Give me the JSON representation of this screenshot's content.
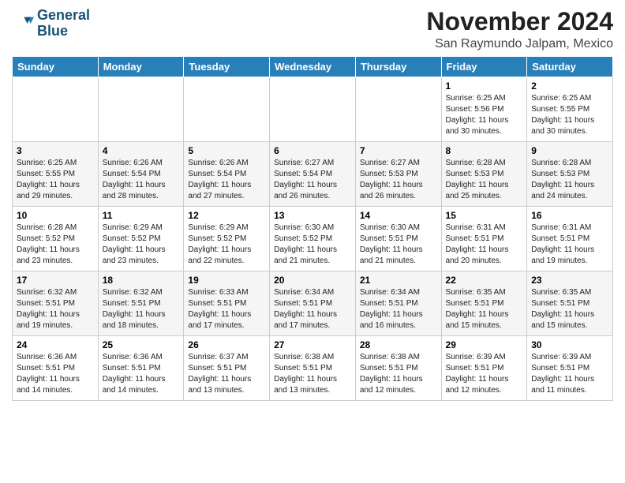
{
  "logo": {
    "line1": "General",
    "line2": "Blue"
  },
  "title": "November 2024",
  "location": "San Raymundo Jalpam, Mexico",
  "header": {
    "days": [
      "Sunday",
      "Monday",
      "Tuesday",
      "Wednesday",
      "Thursday",
      "Friday",
      "Saturday"
    ]
  },
  "weeks": [
    [
      {
        "day": "",
        "info": ""
      },
      {
        "day": "",
        "info": ""
      },
      {
        "day": "",
        "info": ""
      },
      {
        "day": "",
        "info": ""
      },
      {
        "day": "",
        "info": ""
      },
      {
        "day": "1",
        "info": "Sunrise: 6:25 AM\nSunset: 5:56 PM\nDaylight: 11 hours and 30 minutes."
      },
      {
        "day": "2",
        "info": "Sunrise: 6:25 AM\nSunset: 5:55 PM\nDaylight: 11 hours and 30 minutes."
      }
    ],
    [
      {
        "day": "3",
        "info": "Sunrise: 6:25 AM\nSunset: 5:55 PM\nDaylight: 11 hours and 29 minutes."
      },
      {
        "day": "4",
        "info": "Sunrise: 6:26 AM\nSunset: 5:54 PM\nDaylight: 11 hours and 28 minutes."
      },
      {
        "day": "5",
        "info": "Sunrise: 6:26 AM\nSunset: 5:54 PM\nDaylight: 11 hours and 27 minutes."
      },
      {
        "day": "6",
        "info": "Sunrise: 6:27 AM\nSunset: 5:54 PM\nDaylight: 11 hours and 26 minutes."
      },
      {
        "day": "7",
        "info": "Sunrise: 6:27 AM\nSunset: 5:53 PM\nDaylight: 11 hours and 26 minutes."
      },
      {
        "day": "8",
        "info": "Sunrise: 6:28 AM\nSunset: 5:53 PM\nDaylight: 11 hours and 25 minutes."
      },
      {
        "day": "9",
        "info": "Sunrise: 6:28 AM\nSunset: 5:53 PM\nDaylight: 11 hours and 24 minutes."
      }
    ],
    [
      {
        "day": "10",
        "info": "Sunrise: 6:28 AM\nSunset: 5:52 PM\nDaylight: 11 hours and 23 minutes."
      },
      {
        "day": "11",
        "info": "Sunrise: 6:29 AM\nSunset: 5:52 PM\nDaylight: 11 hours and 23 minutes."
      },
      {
        "day": "12",
        "info": "Sunrise: 6:29 AM\nSunset: 5:52 PM\nDaylight: 11 hours and 22 minutes."
      },
      {
        "day": "13",
        "info": "Sunrise: 6:30 AM\nSunset: 5:52 PM\nDaylight: 11 hours and 21 minutes."
      },
      {
        "day": "14",
        "info": "Sunrise: 6:30 AM\nSunset: 5:51 PM\nDaylight: 11 hours and 21 minutes."
      },
      {
        "day": "15",
        "info": "Sunrise: 6:31 AM\nSunset: 5:51 PM\nDaylight: 11 hours and 20 minutes."
      },
      {
        "day": "16",
        "info": "Sunrise: 6:31 AM\nSunset: 5:51 PM\nDaylight: 11 hours and 19 minutes."
      }
    ],
    [
      {
        "day": "17",
        "info": "Sunrise: 6:32 AM\nSunset: 5:51 PM\nDaylight: 11 hours and 19 minutes."
      },
      {
        "day": "18",
        "info": "Sunrise: 6:32 AM\nSunset: 5:51 PM\nDaylight: 11 hours and 18 minutes."
      },
      {
        "day": "19",
        "info": "Sunrise: 6:33 AM\nSunset: 5:51 PM\nDaylight: 11 hours and 17 minutes."
      },
      {
        "day": "20",
        "info": "Sunrise: 6:34 AM\nSunset: 5:51 PM\nDaylight: 11 hours and 17 minutes."
      },
      {
        "day": "21",
        "info": "Sunrise: 6:34 AM\nSunset: 5:51 PM\nDaylight: 11 hours and 16 minutes."
      },
      {
        "day": "22",
        "info": "Sunrise: 6:35 AM\nSunset: 5:51 PM\nDaylight: 11 hours and 15 minutes."
      },
      {
        "day": "23",
        "info": "Sunrise: 6:35 AM\nSunset: 5:51 PM\nDaylight: 11 hours and 15 minutes."
      }
    ],
    [
      {
        "day": "24",
        "info": "Sunrise: 6:36 AM\nSunset: 5:51 PM\nDaylight: 11 hours and 14 minutes."
      },
      {
        "day": "25",
        "info": "Sunrise: 6:36 AM\nSunset: 5:51 PM\nDaylight: 11 hours and 14 minutes."
      },
      {
        "day": "26",
        "info": "Sunrise: 6:37 AM\nSunset: 5:51 PM\nDaylight: 11 hours and 13 minutes."
      },
      {
        "day": "27",
        "info": "Sunrise: 6:38 AM\nSunset: 5:51 PM\nDaylight: 11 hours and 13 minutes."
      },
      {
        "day": "28",
        "info": "Sunrise: 6:38 AM\nSunset: 5:51 PM\nDaylight: 11 hours and 12 minutes."
      },
      {
        "day": "29",
        "info": "Sunrise: 6:39 AM\nSunset: 5:51 PM\nDaylight: 11 hours and 12 minutes."
      },
      {
        "day": "30",
        "info": "Sunrise: 6:39 AM\nSunset: 5:51 PM\nDaylight: 11 hours and 11 minutes."
      }
    ]
  ]
}
